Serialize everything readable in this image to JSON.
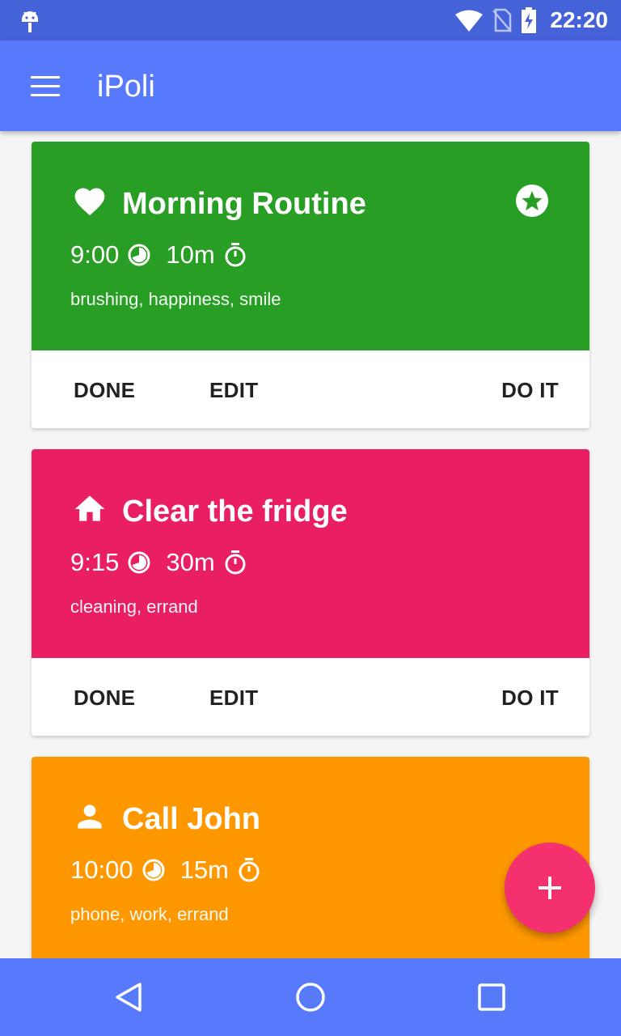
{
  "status_bar": {
    "time": "22:20",
    "icons": [
      "android-debug-icon",
      "wifi-icon",
      "no-sim-icon",
      "battery-charging-icon"
    ]
  },
  "app_bar": {
    "title": "iPoli",
    "menu_icon": "hamburger-menu-icon"
  },
  "colors": {
    "status_bar": "#4662d9",
    "app_bar": "#5779fc",
    "fab": "#f4306e",
    "card_wellness": "#289f24",
    "card_chores": "#e91e63",
    "card_personal": "#ff9800"
  },
  "quests": [
    {
      "title": "Morning Routine",
      "start_time": "9:00",
      "duration": "10m",
      "tags": "brushing, happiness, smile",
      "category_icon": "heart-icon",
      "starred": true,
      "color": "#289f24",
      "actions": {
        "done": "DONE",
        "edit": "EDIT",
        "do_it": "DO IT"
      }
    },
    {
      "title": "Clear the fridge",
      "start_time": "9:15",
      "duration": "30m",
      "tags": "cleaning, errand",
      "category_icon": "home-icon",
      "starred": false,
      "color": "#e91e63",
      "actions": {
        "done": "DONE",
        "edit": "EDIT",
        "do_it": "DO IT"
      }
    },
    {
      "title": "Call John",
      "start_time": "10:00",
      "duration": "15m",
      "tags": "phone, work, errand",
      "category_icon": "person-icon",
      "starred": false,
      "color": "#ff9800"
    }
  ],
  "fab": {
    "icon": "plus-icon"
  },
  "nav_bar": {
    "icons": [
      "back-icon",
      "home-icon",
      "recents-icon"
    ]
  }
}
